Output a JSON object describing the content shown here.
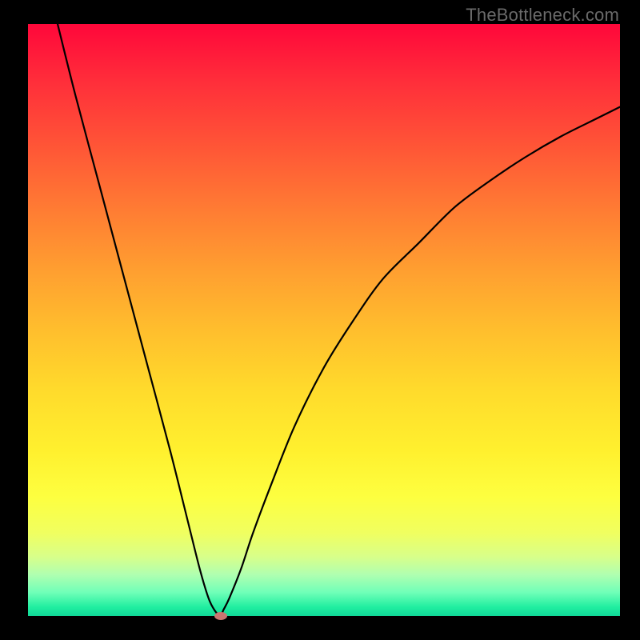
{
  "watermark": "TheBottleneck.com",
  "colors": {
    "frame": "#000000",
    "curve": "#000000",
    "marker": "#cb7571",
    "gradient_top": "#ff073a",
    "gradient_bottom": "#10d898"
  },
  "chart_data": {
    "type": "line",
    "title": "",
    "xlabel": "",
    "ylabel": "",
    "xlim": [
      0,
      100
    ],
    "ylim": [
      0,
      100
    ],
    "grid": false,
    "legend": false,
    "series": [
      {
        "name": "bottleneck-curve",
        "x": [
          5,
          8,
          12,
          16,
          20,
          24,
          27,
          29,
          30.5,
          31.5,
          32.5,
          33,
          34,
          36,
          38,
          41,
          45,
          50,
          55,
          60,
          66,
          72,
          78,
          84,
          90,
          96,
          100
        ],
        "values": [
          100,
          88,
          73,
          58,
          43,
          28,
          16,
          8,
          3,
          1,
          0,
          1,
          3,
          8,
          14,
          22,
          32,
          42,
          50,
          57,
          63,
          69,
          73.5,
          77.5,
          81,
          84,
          86
        ]
      }
    ],
    "annotations": [
      {
        "name": "optimum-marker",
        "x": 32.5,
        "y": 0
      }
    ]
  }
}
